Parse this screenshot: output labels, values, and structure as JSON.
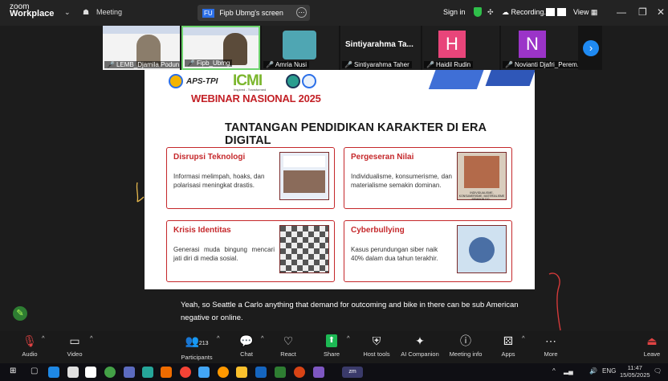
{
  "titlebar": {
    "brand_top": "zoom",
    "brand_bottom": "Workplace",
    "meeting_label": "Meeting",
    "share_badge": "FU",
    "share_title": "Fipb Ubmg's screen",
    "sign_in": "Sign in",
    "recording": "Recording...",
    "view": "View"
  },
  "gallery": {
    "tiles": [
      {
        "name": "LEMB_Djamila Podun"
      },
      {
        "name": "Fipb_Ubmg"
      },
      {
        "name": "Amria Nusi"
      },
      {
        "name": "Sintiyarahma Taher",
        "display": "Sintiyarahma Ta..."
      },
      {
        "name": "Haidil Rudin",
        "initial": "H"
      },
      {
        "name": "Novianti Djafri_Perem...",
        "initial": "N"
      }
    ]
  },
  "slide": {
    "logo_apstpi": "APS-TPI",
    "logo_icmi": "ICMI",
    "logo_icmi_sub": "Inspired - Transformed",
    "webinar": "WEBINAR NASIONAL 2025",
    "title": "TANTANGAN PENDIDIKAN KARAKTER DI ERA DIGITAL",
    "cards": [
      {
        "heading": "Disrupsi Teknologi",
        "body": "Informasi melimpah, hoaks, dan polarisasi meningkat drastis."
      },
      {
        "heading": "Pergeseran Nilai",
        "body": "Individualisme, konsumerisme, dan materialisme semakin dominan.",
        "thumb_caption": "INDIVIDUALISME, KONSUMERISME, MATERIALISME SEMAKIN DO..."
      },
      {
        "heading": "Krisis Identitas",
        "body": "Generasi muda bingung mencari jati diri di media sosial."
      },
      {
        "heading": "Cyberbullying",
        "body": "Kasus perundungan siber naik 40% dalam dua tahun terakhir."
      }
    ]
  },
  "caption": "Yeah, so Seattle a Carlo anything that demand for outcoming and bike in there can be sub American negative or online.",
  "toolbar": {
    "audio": "Audio",
    "video": "Video",
    "participants": "Participants",
    "participants_count": "213",
    "chat": "Chat",
    "react": "React",
    "share": "Share",
    "host_tools": "Host tools",
    "ai_companion": "AI Companion",
    "meeting_info": "Meeting info",
    "apps": "Apps",
    "more": "More",
    "leave": "Leave"
  },
  "taskbar": {
    "lang": "ENG",
    "time": "11:47",
    "date": "15/05/2025"
  },
  "colors": {
    "accent_red": "#c5282b",
    "zoom_blue": "#1f8af2",
    "share_green": "#1db954"
  }
}
